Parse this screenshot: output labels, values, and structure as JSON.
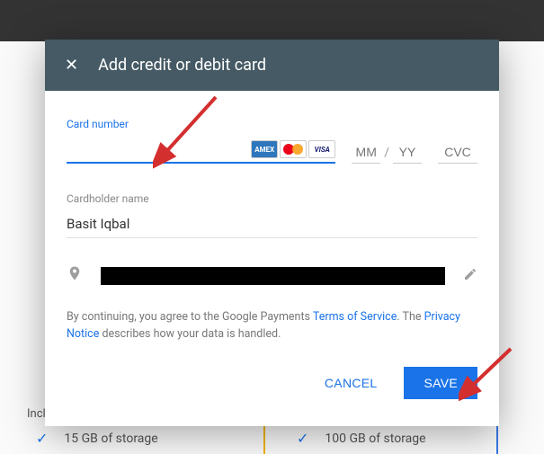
{
  "modal": {
    "title": "Add credit or debit card",
    "card_number_label": "Card number",
    "mm_placeholder": "MM",
    "yy_placeholder": "YY",
    "cvc_placeholder": "CVC",
    "cardholder_label": "Cardholder name",
    "cardholder_value": "Basit Iqbal",
    "legal_prefix": "By continuing, you agree to the Google Payments ",
    "tos": "Terms of Service",
    "legal_mid": ". The ",
    "privacy": "Privacy Notice",
    "legal_suffix": " describes how your data is handled.",
    "cancel": "CANCEL",
    "save": "SAVE"
  },
  "background": {
    "included_label": "Incl",
    "plan_left": "15 GB of storage",
    "plan_right": "100 GB of storage"
  },
  "icons": {
    "amex": "AMEX",
    "visa": "VISA"
  }
}
